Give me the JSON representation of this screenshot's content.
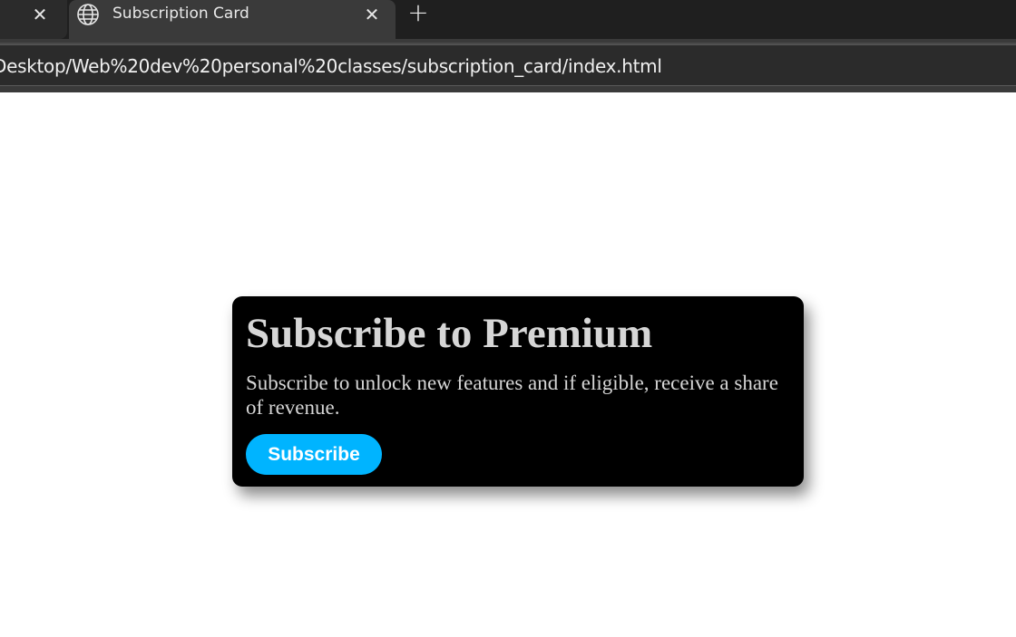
{
  "browser": {
    "tab_title": "Subscription Card",
    "close_glyph": "✕",
    "new_tab_glyph": "+",
    "url": "Desktop/Web%20dev%20personal%20classes/subscription_card/index.html",
    "icons": [
      "close-icon",
      "globe-icon",
      "plus-icon"
    ]
  },
  "card": {
    "heading": "Subscribe to Premium",
    "description": "Subscribe to unlock new features and if eligible, receive a share of revenue.",
    "button_label": "Subscribe",
    "colors": {
      "card_bg": "#000000",
      "text": "#d6d6d6",
      "button_bg": "#00b4ff",
      "button_text": "#ffffff"
    }
  }
}
